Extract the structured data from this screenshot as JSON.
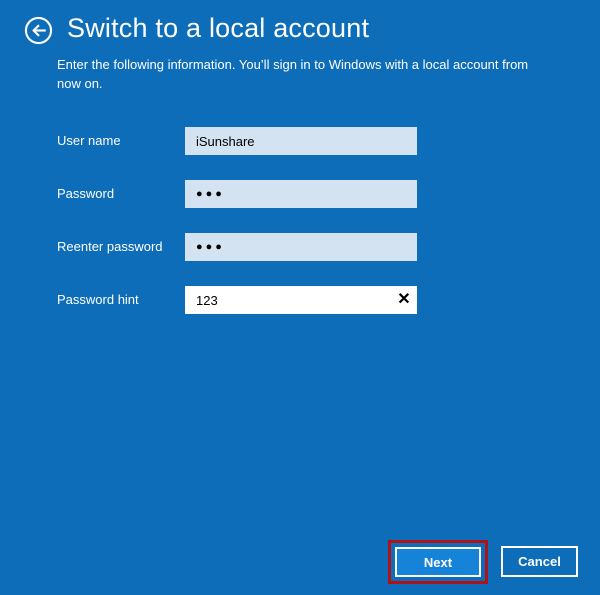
{
  "colors": {
    "background": "#0d6db8",
    "field_background": "#d3e3f2",
    "focused_field_background": "#ffffff",
    "next_button_background": "#1583d8",
    "button_border": "#ffffff",
    "highlight_border": "#b01217",
    "text": "#ffffff",
    "input_text": "#000000"
  },
  "header": {
    "back_icon": "back-arrow-circle",
    "title": "Switch to a local account",
    "subtitle_lines": [
      "Enter the following information. You’ll sign in to Windows with a local account from",
      "now on."
    ]
  },
  "form": {
    "fields": [
      {
        "label": "User name",
        "value": "iSunshare",
        "type": "text"
      },
      {
        "label": "Password",
        "value": "●●●",
        "type": "password"
      },
      {
        "label": "Reenter password",
        "value": "●●●",
        "type": "password"
      },
      {
        "label": "Password hint",
        "value": "123",
        "type": "text",
        "clear_icon": "✕"
      }
    ]
  },
  "footer": {
    "next_label": "Next",
    "cancel_label": "Cancel",
    "next_highlighted": true
  }
}
